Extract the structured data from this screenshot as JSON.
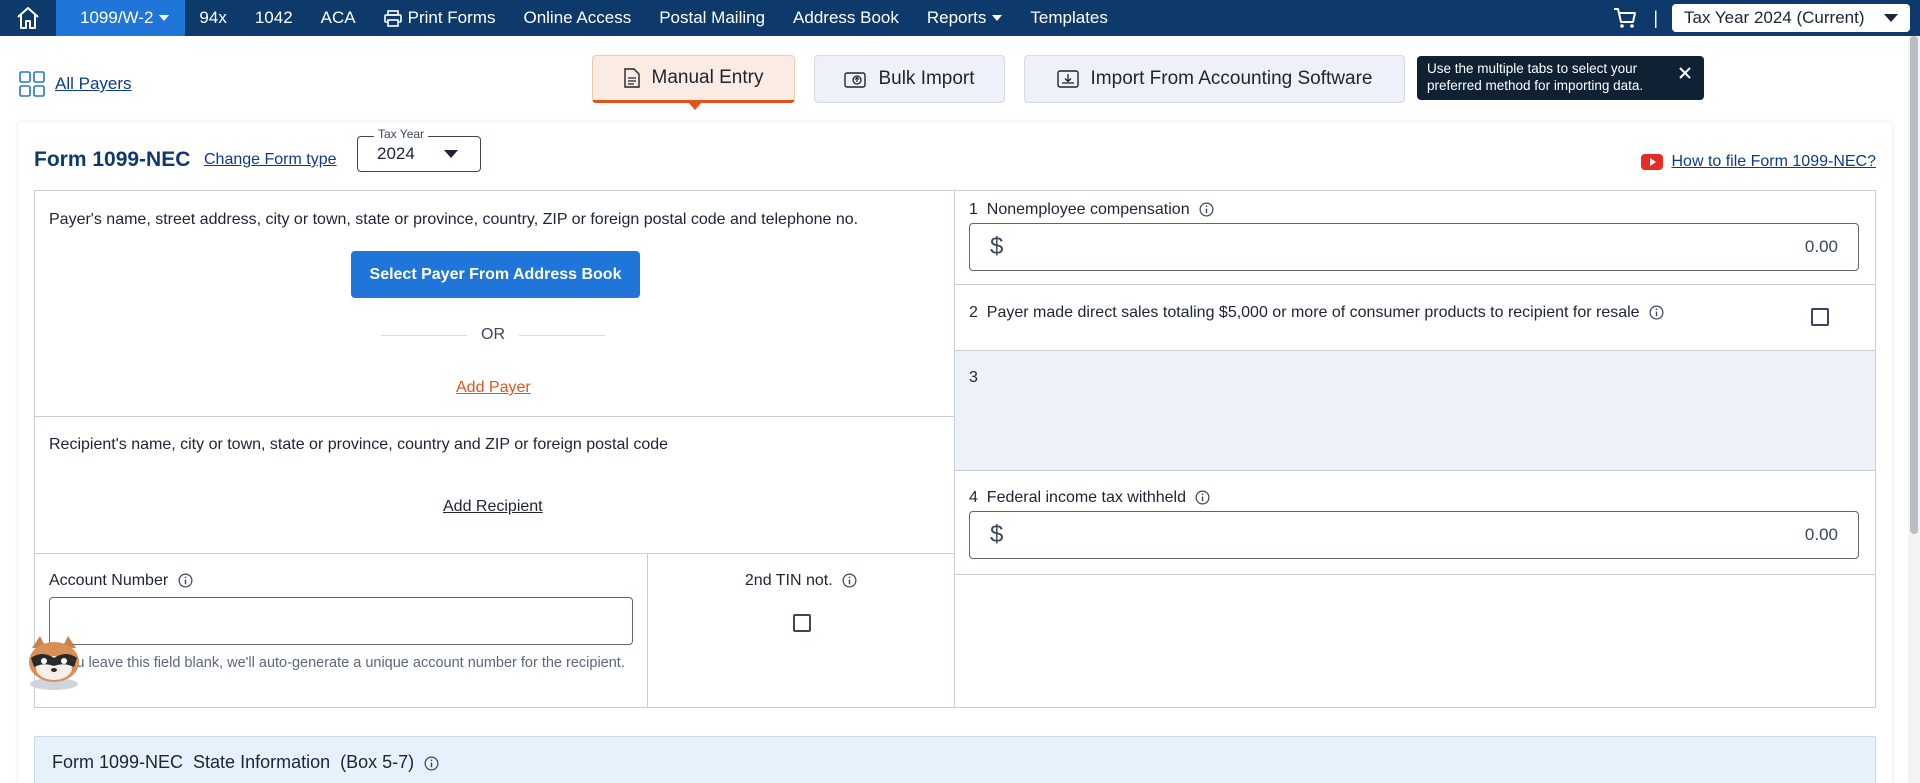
{
  "nav": {
    "items": [
      {
        "label": "1099/W-2",
        "active": true,
        "dropdown": true
      },
      {
        "label": "94x"
      },
      {
        "label": "1042"
      },
      {
        "label": "ACA"
      },
      {
        "label": "Print Forms",
        "icon": "printer-icon"
      },
      {
        "label": "Online Access"
      },
      {
        "label": "Postal Mailing"
      },
      {
        "label": "Address Book"
      },
      {
        "label": "Reports",
        "dropdown": true
      },
      {
        "label": "Templates"
      }
    ],
    "tax_year": "Tax Year 2024 (Current)"
  },
  "subheader": {
    "all_payers": "All Payers",
    "tabs": [
      {
        "label": "Manual Entry",
        "active": true
      },
      {
        "label": "Bulk Import"
      },
      {
        "label": "Import From Accounting Software"
      }
    ],
    "tooltip": "Use the multiple tabs to select your preferred method for importing data."
  },
  "form": {
    "title": "Form 1099-NEC",
    "change_type": "Change Form type",
    "year_legend": "Tax Year",
    "year_value": "2024",
    "how_to": "How to file Form 1099-NEC?",
    "payer": {
      "label": "Payer's name, street address, city or town, state or province, country, ZIP or foreign postal code and telephone no.",
      "select_button": "Select Payer From Address Book",
      "or": "OR",
      "add_link": "Add Payer"
    },
    "recipient": {
      "label": "Recipient's name, city or town, state or province, country and ZIP or foreign postal code",
      "add_link": "Add Recipient"
    },
    "account": {
      "label": "Account Number",
      "value": "",
      "hint": "If you leave this field blank, we'll auto-generate a unique account number for the recipient."
    },
    "second_tin": {
      "label": "2nd TIN not."
    },
    "box1": {
      "number": "1",
      "label": "Nonemployee compensation",
      "currency": "$",
      "value": "0.00"
    },
    "box2": {
      "number": "2",
      "label": "Payer made direct sales totaling $5,000 or more of consumer products to recipient for resale"
    },
    "box3": {
      "number": "3"
    },
    "box4": {
      "number": "4",
      "label": "Federal income tax withheld",
      "currency": "$",
      "value": "0.00"
    }
  },
  "state": {
    "title": "Form 1099-NEC  State Information  (Box 5-7)"
  },
  "colors": {
    "nav_bg": "#0d3a6b",
    "nav_active": "#1f76d8",
    "accent_orange": "#e0561a",
    "primary_button": "#1f76d8"
  }
}
